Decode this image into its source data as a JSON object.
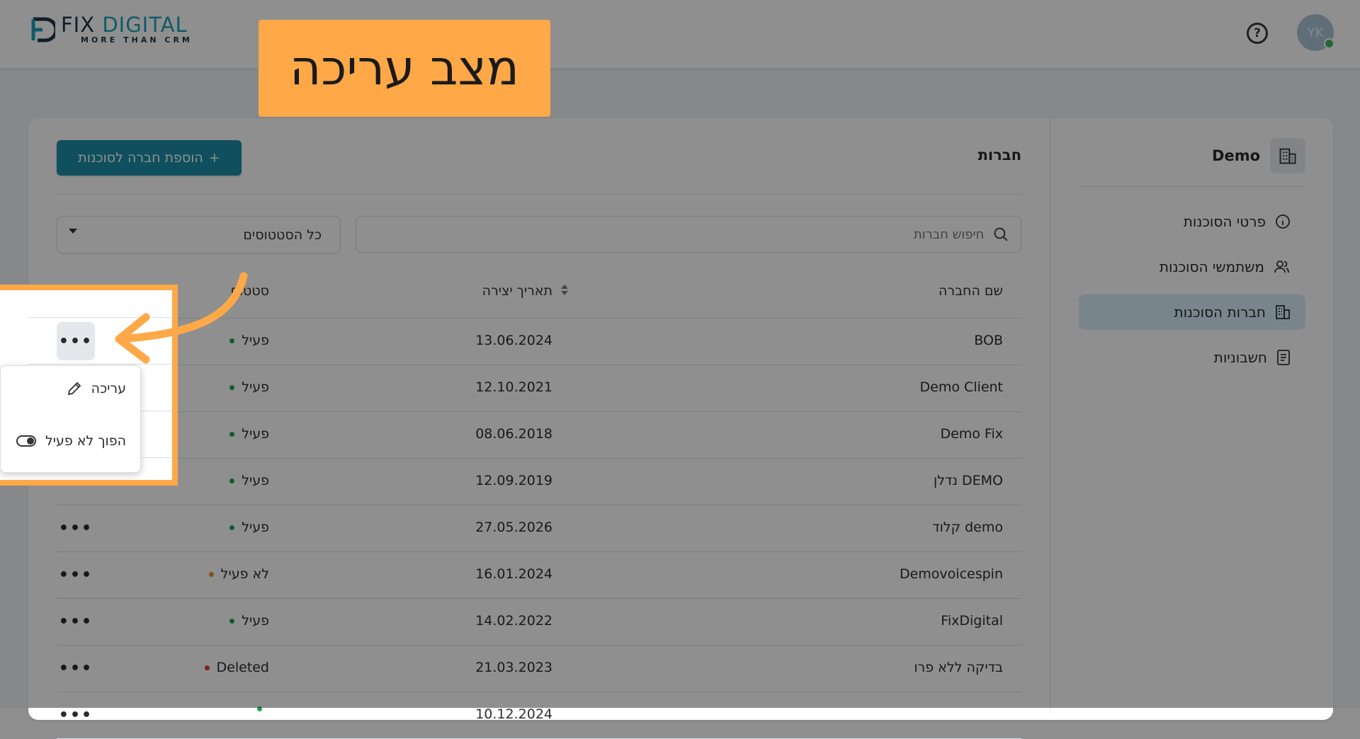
{
  "header": {
    "logo_main_a": "FIX ",
    "logo_main_b": "DIGITAL",
    "logo_sub": "MORE THAN CRM",
    "help_icon": "?",
    "avatar_initials": "YK"
  },
  "sidebar": {
    "title": "Demo",
    "items": [
      {
        "label": "פרטי הסוכנות",
        "icon": "info-icon",
        "active": false
      },
      {
        "label": "משתמשי הסוכנות",
        "icon": "users-icon",
        "active": false
      },
      {
        "label": "חברות הסוכנות",
        "icon": "building-icon",
        "active": true
      },
      {
        "label": "חשבוניות",
        "icon": "invoice-icon",
        "active": false
      }
    ]
  },
  "main": {
    "title": "חברות",
    "add_button": "הוספת חברה לסוכנות",
    "add_button_plus": "+",
    "search_placeholder": "חיפוש חברות",
    "status_filter": "כל הסטטוסים"
  },
  "table": {
    "headers": {
      "name": "שם החברה",
      "date": "תאריך יצירה",
      "status": "סטטוס"
    },
    "more_label": "•••",
    "rows": [
      {
        "name": "BOB",
        "date": "13.06.2024",
        "status": "פעיל",
        "status_color": "green"
      },
      {
        "name": "Demo Client",
        "date": "12.10.2021",
        "status": "פעיל",
        "status_color": "green"
      },
      {
        "name": "Demo Fix",
        "date": "08.06.2018",
        "status": "פעיל",
        "status_color": "green"
      },
      {
        "name": "DEMO נדלן",
        "date": "12.09.2019",
        "status": "פעיל",
        "status_color": "green"
      },
      {
        "name": "demo קלוד",
        "date": "27.05.2026",
        "status": "פעיל",
        "status_color": "green"
      },
      {
        "name": "Demovoicespin",
        "date": "16.01.2024",
        "status": "לא פעיל",
        "status_color": "orange"
      },
      {
        "name": "FixDigital",
        "date": "14.02.2022",
        "status": "פעיל",
        "status_color": "green"
      },
      {
        "name": "בדיקה ללא פרו",
        "date": "21.03.2023",
        "status": "Deleted",
        "status_color": "red"
      },
      {
        "name": "",
        "date": "10.12.2024",
        "status": "",
        "status_color": "green"
      }
    ]
  },
  "row_menu": {
    "edit": "עריכה",
    "toggle_inactive": "הפוך לא פעיל"
  },
  "callout": {
    "text": "מצב עריכה"
  },
  "colors": {
    "accent": "#1d8fa8",
    "highlight": "#ffa847",
    "active_nav": "#d6eefc"
  }
}
